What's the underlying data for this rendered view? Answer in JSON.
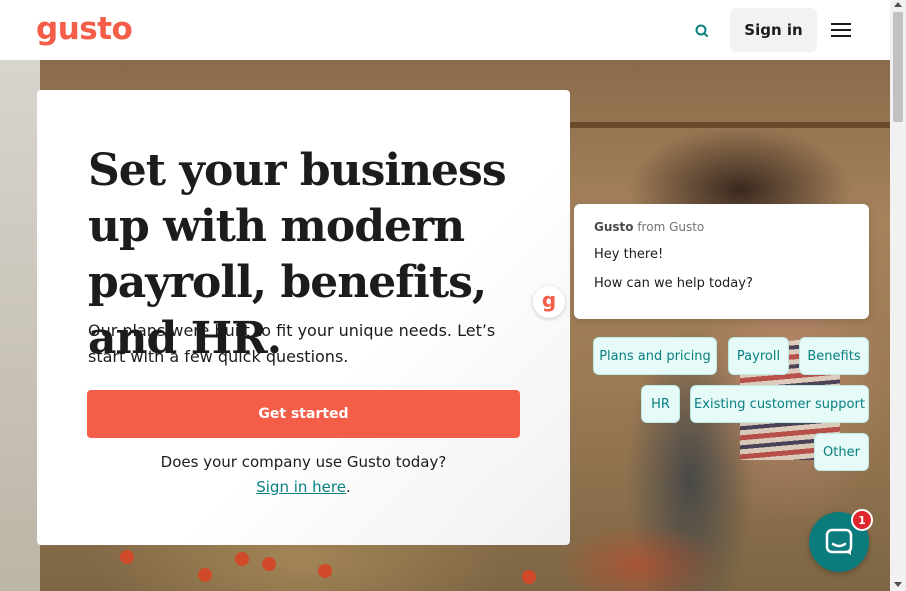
{
  "header": {
    "logo": "gusto",
    "signin_label": "Sign in"
  },
  "hero": {
    "headline": "Set your business up with modern payroll, benefits, and HR.",
    "subtext": "Our plans were built to fit your unique needs. Let’s start with a few quick questions.",
    "cta_label": "Get started",
    "question": "Does your company use Gusto today?",
    "signin_link": "Sign in here",
    "signin_suffix": "."
  },
  "chat": {
    "avatar_letter": "g",
    "from_name": "Gusto",
    "from_suffix": " from Gusto",
    "line1": "Hey there!",
    "line2": "How can we help today?",
    "chips": [
      "Plans and pricing",
      "Payroll",
      "Benefits",
      "HR",
      "Existing customer support",
      "Other"
    ],
    "unread_count": "1"
  },
  "colors": {
    "brand": "#f45d48",
    "accent": "#0a8080",
    "launcher": "#0c7b7c"
  },
  "icons": [
    "search-icon",
    "hamburger-menu-icon",
    "chat-icon"
  ]
}
